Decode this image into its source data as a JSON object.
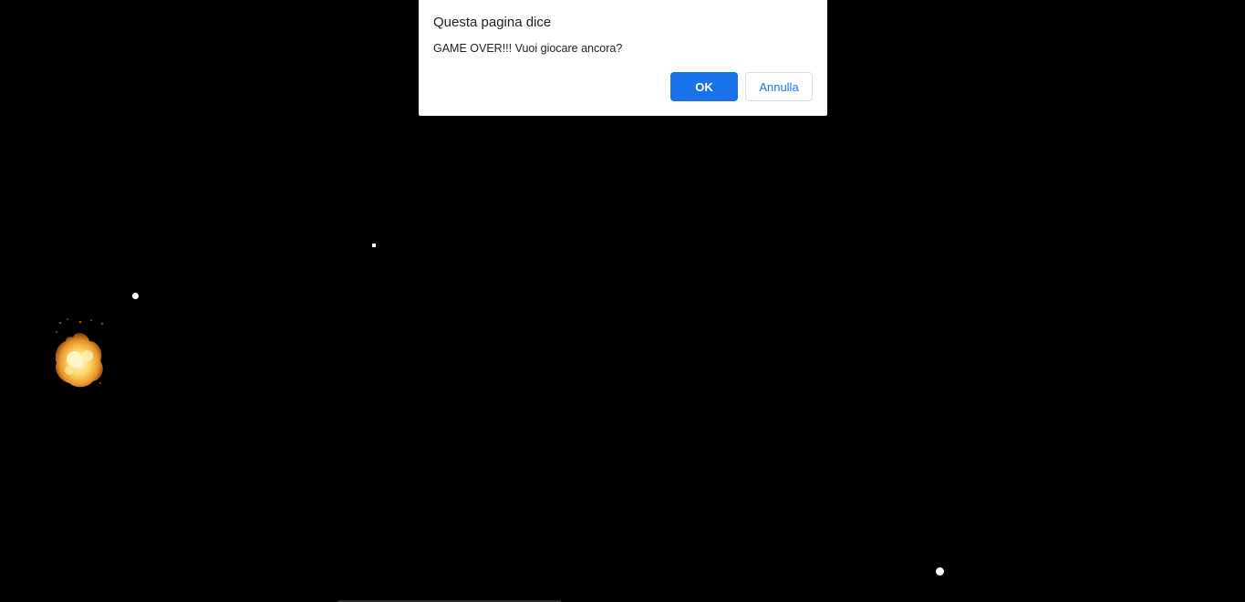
{
  "dialog": {
    "title": "Questa pagina dice",
    "message": "GAME OVER!!! Vuoi giocare ancora?",
    "ok_label": "OK",
    "cancel_label": "Annulla"
  },
  "game": {
    "background_color": "#000000",
    "explosion_icon": "explosion-icon",
    "object_color": "#ffffff"
  },
  "colors": {
    "accent": "#1a73e8",
    "dialog_background": "#ffffff"
  }
}
